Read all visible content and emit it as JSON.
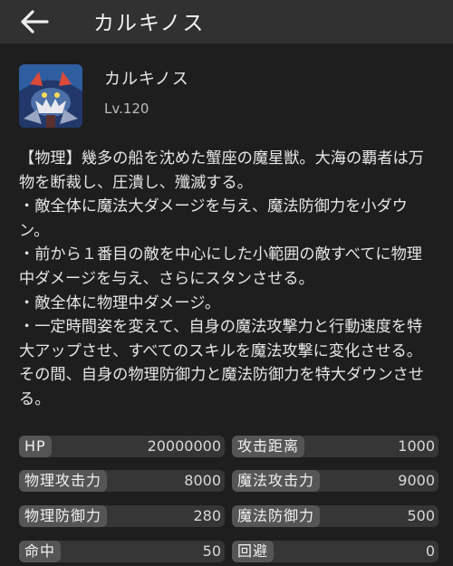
{
  "header": {
    "title": "カルキノス"
  },
  "unit": {
    "name": "カルキノス",
    "level": "Lv.120"
  },
  "description": [
    "【物理】幾多の船を沈めた蟹座の魔星獣。大海の覇者は万物を断裁し、圧潰し、殲滅する。",
    "・敵全体に魔法大ダメージを与え、魔法防御力を小ダウン。",
    "・前から１番目の敵を中心にした小範囲の敵すべてに物理中ダメージを与え、さらにスタンさせる。",
    "・敵全体に物理中ダメージ。",
    "・一定時間姿を変えて、自身の魔法攻撃力と行動速度を特大アップさせ、すべてのスキルを魔法攻撃に変化させる。その間、自身の物理防御力と魔法防御力を特大ダウンさせる。"
  ],
  "stats": [
    {
      "label": "HP",
      "value": "20000000"
    },
    {
      "label": "攻击距离",
      "value": "1000"
    },
    {
      "label": "物理攻击力",
      "value": "8000"
    },
    {
      "label": "魔法攻击力",
      "value": "9000"
    },
    {
      "label": "物理防御力",
      "value": "280"
    },
    {
      "label": "魔法防御力",
      "value": "500"
    },
    {
      "label": "命中",
      "value": "50"
    },
    {
      "label": "回避",
      "value": "0"
    }
  ]
}
